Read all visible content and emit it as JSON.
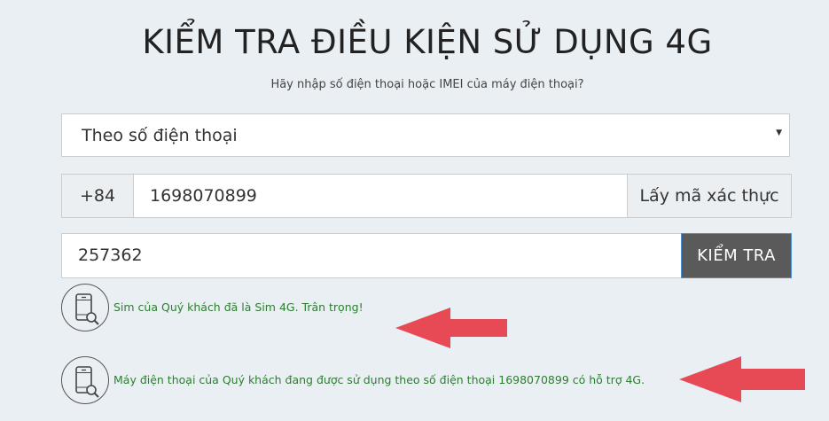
{
  "header": {
    "title": "KIỂM TRA ĐIỀU KIỆN SỬ DỤNG 4G",
    "subtitle": "Hãy nhập số điện thoại hoặc IMEI của máy điện thoại?"
  },
  "form": {
    "mode_select": {
      "selected": "Theo số điện thoại"
    },
    "country_code": "+84",
    "phone_number": "1698070899",
    "otp_button_label": "Lấy mã xác thực",
    "verification_code": "257362",
    "check_button_label": "KIỂM TRA"
  },
  "results": [
    {
      "icon": "phone-search-icon",
      "message": "Sim của Quý khách đã là Sim 4G. Trân trọng!"
    },
    {
      "icon": "phone-search-icon",
      "message": "Máy điện thoại của Quý khách đang được sử dụng theo số điện thoại 1698070899 có hỗ trợ 4G."
    }
  ],
  "colors": {
    "background": "#eaeff4",
    "success_text": "#2e7d32",
    "check_button": "#5a5a5a",
    "annotation_arrow": "#e84a55"
  }
}
